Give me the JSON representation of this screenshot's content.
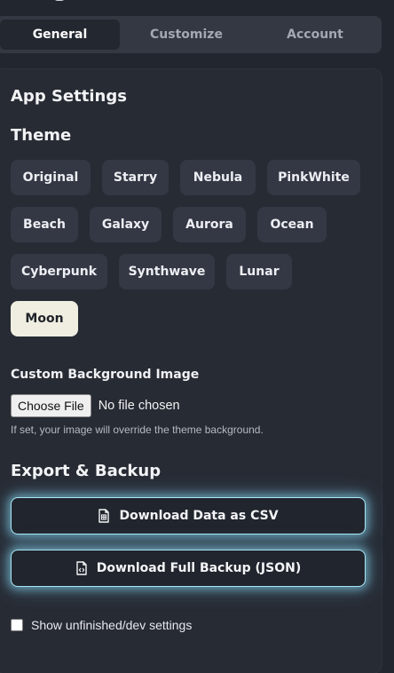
{
  "tabs": {
    "general": "General",
    "customize": "Customize",
    "account": "Account"
  },
  "headings": {
    "app_settings": "App Settings",
    "theme": "Theme",
    "export": "Export & Backup"
  },
  "themes": [
    "Original",
    "Starry",
    "Nebula",
    "PinkWhite",
    "Beach",
    "Galaxy",
    "Aurora",
    "Ocean",
    "Cyberpunk",
    "Synthwave",
    "Lunar",
    "Moon"
  ],
  "selected_theme": "Moon",
  "custom_bg": {
    "label": "Custom Background Image",
    "button": "Choose File",
    "status": "No file chosen",
    "helper": "If set, your image will override the theme background."
  },
  "export": {
    "csv_label": "Download Data as CSV",
    "json_label": "Download Full Backup (JSON)"
  },
  "dev_toggle": {
    "label": "Show unfinished/dev settings",
    "checked": false
  },
  "colors": {
    "background": "#22262f",
    "chip": "#343844",
    "selected_chip": "#efeee0",
    "glow": "#a9e7f6"
  },
  "icons": {
    "csv": "file-spreadsheet-icon",
    "json": "file-code-icon"
  }
}
